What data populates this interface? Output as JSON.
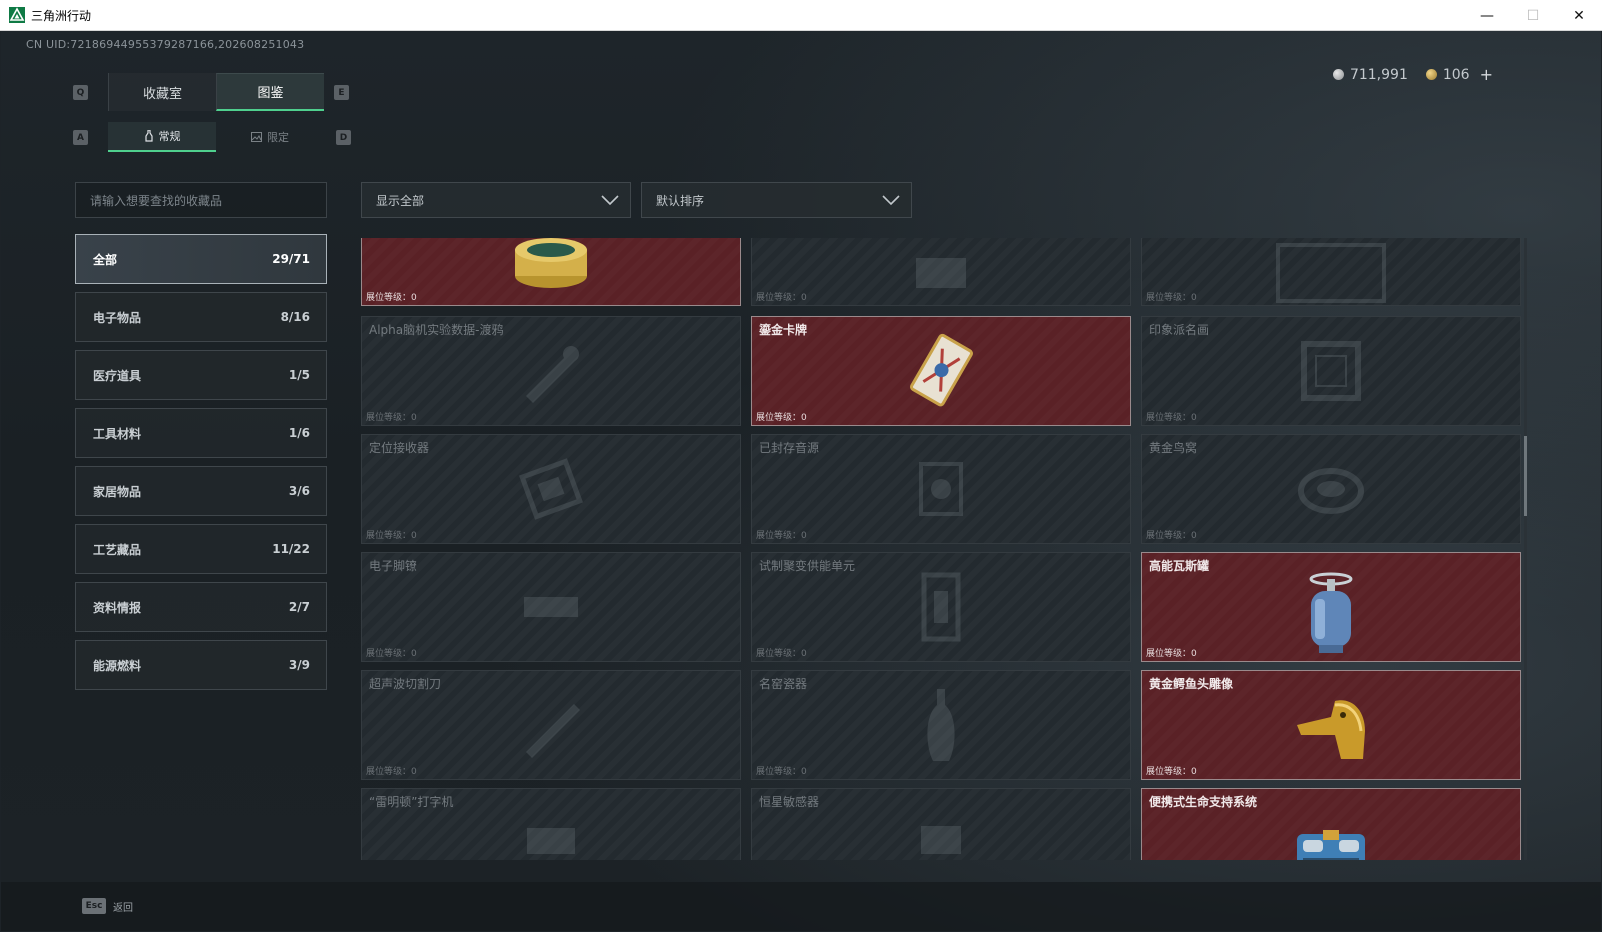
{
  "window": {
    "title": "三角洲行动",
    "controls": {
      "minimize": "—",
      "maximize": "☐",
      "close": "✕"
    }
  },
  "uid": "CN UID:72186944955379287166,202608251043",
  "currency": {
    "silver": "711,991",
    "gold": "106",
    "add": "+"
  },
  "keyhints": {
    "q": "Q",
    "e": "E",
    "a": "A",
    "d": "D"
  },
  "tabs": [
    {
      "label": "收藏室",
      "active": false
    },
    {
      "label": "图鉴",
      "active": true
    }
  ],
  "subtabs": [
    {
      "label": "常规",
      "icon": "bottle-icon",
      "active": true
    },
    {
      "label": "限定",
      "icon": "image-icon",
      "active": false
    }
  ],
  "search": {
    "placeholder": "请输入想要查找的收藏品"
  },
  "filters": {
    "display": "显示全部",
    "sort": "默认排序"
  },
  "categories": [
    {
      "label": "全部",
      "count": "29/71",
      "active": true
    },
    {
      "label": "电子物品",
      "count": "8/16"
    },
    {
      "label": "医疗道具",
      "count": "1/5"
    },
    {
      "label": "工具材料",
      "count": "1/6"
    },
    {
      "label": "家居物品",
      "count": "3/6"
    },
    {
      "label": "工艺藏品",
      "count": "11/22"
    },
    {
      "label": "资料情报",
      "count": "2/7"
    },
    {
      "label": "能源燃料",
      "count": "3/9"
    }
  ],
  "items": [
    {
      "name": "",
      "level": "展位等级：0",
      "owned": true,
      "icon": "caviar-tin-icon"
    },
    {
      "name": "",
      "level": "展位等级：0",
      "owned": false,
      "icon": "item-silhouette-icon"
    },
    {
      "name": "",
      "level": "展位等级：0",
      "owned": false,
      "icon": "frame-silhouette-icon"
    },
    {
      "name": "Alpha脑机实验数据-渡鸦",
      "level": "展位等级：0",
      "owned": false,
      "icon": "device-silhouette-icon"
    },
    {
      "name": "鎏金卡牌",
      "level": "展位等级：0",
      "owned": true,
      "icon": "gilded-card-icon"
    },
    {
      "name": "印象派名画",
      "level": "展位等级：0",
      "owned": false,
      "icon": "painting-silhouette-icon"
    },
    {
      "name": "定位接收器",
      "level": "展位等级：0",
      "owned": false,
      "icon": "receiver-silhouette-icon"
    },
    {
      "name": "已封存音源",
      "level": "展位等级：0",
      "owned": false,
      "icon": "sound-source-silhouette-icon"
    },
    {
      "name": "黄金鸟窝",
      "level": "展位等级：0",
      "owned": false,
      "icon": "nest-silhouette-icon"
    },
    {
      "name": "电子脚镣",
      "level": "展位等级：0",
      "owned": false,
      "icon": "anklet-silhouette-icon"
    },
    {
      "name": "试制聚变供能单元",
      "level": "展位等级：0",
      "owned": false,
      "icon": "fusion-cell-silhouette-icon"
    },
    {
      "name": "高能瓦斯罐",
      "level": "展位等级：0",
      "owned": true,
      "icon": "gas-tank-icon"
    },
    {
      "name": "超声波切割刀",
      "level": "展位等级：0",
      "owned": false,
      "icon": "cutter-silhouette-icon"
    },
    {
      "name": "名窑瓷器",
      "level": "展位等级：0",
      "owned": false,
      "icon": "vase-silhouette-icon"
    },
    {
      "name": "黄金鳄鱼头雕像",
      "level": "展位等级：0",
      "owned": true,
      "icon": "gold-crocodile-icon"
    },
    {
      "name": "“雷明顿”打字机",
      "level": "",
      "owned": false,
      "icon": "typewriter-silhouette-icon"
    },
    {
      "name": "恒星敏感器",
      "level": "",
      "owned": false,
      "icon": "sensor-silhouette-icon"
    },
    {
      "name": "便携式生命支持系统",
      "level": "",
      "owned": true,
      "icon": "life-support-icon"
    }
  ],
  "footer": {
    "key": "Esc",
    "label": "返回"
  },
  "colors": {
    "accent": "#4fd08e",
    "owned_card": "#5a2126",
    "locked_card": "#232a2f"
  }
}
